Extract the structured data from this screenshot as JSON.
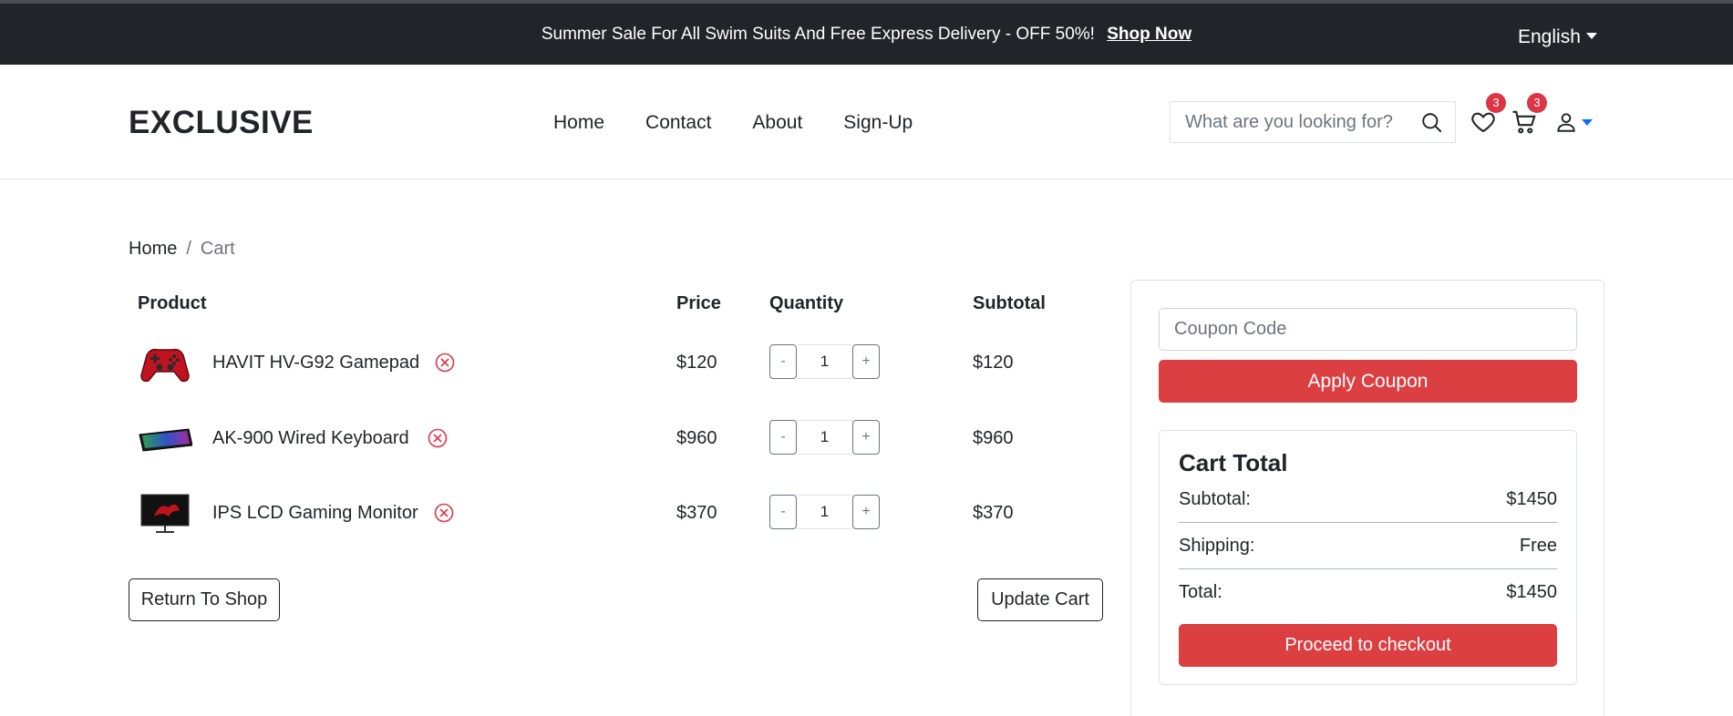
{
  "topbar": {
    "promo_text": "Summer Sale For All Swim Suits And Free Express Delivery - OFF 50%!",
    "promo_link": "Shop Now",
    "language": "English"
  },
  "header": {
    "logo": "EXCLUSIVE",
    "nav": [
      "Home",
      "Contact",
      "About",
      "Sign-Up"
    ],
    "search_placeholder": "What are you looking for?",
    "wishlist_count": "3",
    "cart_count": "3"
  },
  "breadcrumb": {
    "home": "Home",
    "separator": "/",
    "current": "Cart"
  },
  "cart": {
    "headers": {
      "product": "Product",
      "price": "Price",
      "quantity": "Quantity",
      "subtotal": "Subtotal"
    },
    "items": [
      {
        "name": "HAVIT HV-G92 Gamepad",
        "price": "$120",
        "quantity": "1",
        "subtotal": "$120"
      },
      {
        "name": "AK-900 Wired Keyboard",
        "price": "$960",
        "quantity": "1",
        "subtotal": "$960"
      },
      {
        "name": "IPS LCD Gaming Monitor",
        "price": "$370",
        "quantity": "1",
        "subtotal": "$370"
      }
    ],
    "qty_minus": "-",
    "qty_plus": "+",
    "return_label": "Return To Shop",
    "update_label": "Update Cart"
  },
  "summary": {
    "coupon_placeholder": "Coupon Code",
    "apply_label": "Apply Coupon",
    "title": "Cart Total",
    "subtotal_label": "Subtotal:",
    "subtotal_value": "$1450",
    "shipping_label": "Shipping:",
    "shipping_value": "Free",
    "total_label": "Total:",
    "total_value": "$1450",
    "checkout_label": "Proceed to checkout"
  },
  "colors": {
    "topbar_bg": "#212529",
    "accent_red": "#dc3f42",
    "badge_red": "#dc3545"
  }
}
